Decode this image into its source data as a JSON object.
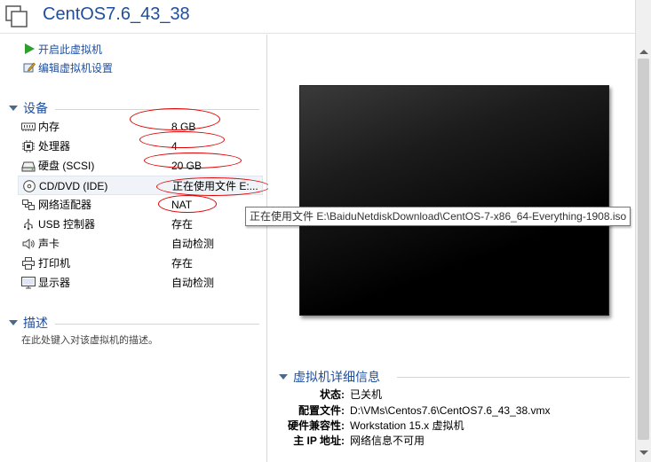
{
  "window": {
    "title": "CentOS7.6_43_38"
  },
  "actions": [
    {
      "label": "开启此虚拟机",
      "icon": "play-icon"
    },
    {
      "label": "编辑虚拟机设置",
      "icon": "edit-settings-icon"
    }
  ],
  "devices_section": {
    "title": "设备"
  },
  "devices": [
    {
      "name": "内存",
      "value": "8 GB",
      "icon": "memory-icon"
    },
    {
      "name": "处理器",
      "value": "4",
      "icon": "cpu-icon"
    },
    {
      "name": "硬盘 (SCSI)",
      "value": "20 GB",
      "icon": "hard-disk-icon"
    },
    {
      "name": "CD/DVD (IDE)",
      "value": "正在使用文件 E:...",
      "icon": "cd-dvd-icon"
    },
    {
      "name": "网络适配器",
      "value": "NAT",
      "icon": "network-adapter-icon"
    },
    {
      "name": "USB 控制器",
      "value": "存在",
      "icon": "usb-icon"
    },
    {
      "name": "声卡",
      "value": "自动检测",
      "icon": "sound-card-icon"
    },
    {
      "name": "打印机",
      "value": "存在",
      "icon": "printer-icon"
    },
    {
      "name": "显示器",
      "value": "自动检测",
      "icon": "display-icon"
    }
  ],
  "description_section": {
    "title": "描述",
    "placeholder": "在此处键入对该虚拟机的描述。"
  },
  "tooltip": {
    "text": "正在使用文件 E:\\BaiduNetdiskDownload\\CentOS-7-x86_64-Everything-1908.iso"
  },
  "details_section": {
    "title": "虚拟机详细信息",
    "rows": [
      {
        "key": "状态:",
        "value": "已关机"
      },
      {
        "key": "配置文件:",
        "value": "D:\\VMs\\Centos7.6\\CentOS7.6_43_38.vmx"
      },
      {
        "key": "硬件兼容性:",
        "value": "Workstation 15.x 虚拟机"
      },
      {
        "key": "主 IP 地址:",
        "value": "网络信息不可用"
      }
    ]
  },
  "colors": {
    "accent": "#1f4e9c",
    "annotation": "#e00000",
    "play": "#2e9e2e"
  }
}
